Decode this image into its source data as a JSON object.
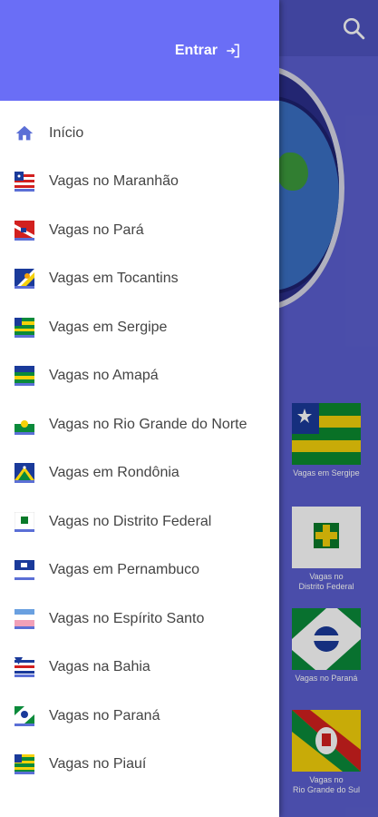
{
  "drawer": {
    "login_label": "Entrar",
    "items": [
      {
        "label": "Início",
        "icon": "home-icon"
      },
      {
        "label": "Vagas no Maranhão",
        "icon": "maranhao-flag-icon"
      },
      {
        "label": "Vagas no Pará",
        "icon": "para-flag-icon"
      },
      {
        "label": "Vagas em Tocantins",
        "icon": "tocantins-flag-icon"
      },
      {
        "label": "Vagas em Sergipe",
        "icon": "sergipe-flag-icon"
      },
      {
        "label": "Vagas no Amapá",
        "icon": "amapa-flag-icon"
      },
      {
        "label": "Vagas no Rio Grande do Norte",
        "icon": "rio-grande-do-norte-flag-icon"
      },
      {
        "label": "Vagas em Rondônia",
        "icon": "rondonia-flag-icon"
      },
      {
        "label": "Vagas no Distrito Federal",
        "icon": "distrito-federal-flag-icon"
      },
      {
        "label": "Vagas em Pernambuco",
        "icon": "pernambuco-flag-icon"
      },
      {
        "label": "Vagas no Espírito Santo",
        "icon": "espirito-santo-flag-icon"
      },
      {
        "label": "Vagas na Bahia",
        "icon": "bahia-flag-icon"
      },
      {
        "label": "Vagas no Paraná",
        "icon": "parana-flag-icon"
      },
      {
        "label": "Vagas no Piauí",
        "icon": "piaui-flag-icon"
      }
    ]
  },
  "background": {
    "cards": [
      {
        "line1": "Vagas em Sergipe",
        "line2": ""
      },
      {
        "line1": "Vagas no",
        "line2": "Distrito Federal"
      },
      {
        "line1": "Vagas no Paraná",
        "line2": ""
      },
      {
        "line1": "Vagas no",
        "line2": "Rio Grande do Sul"
      }
    ]
  },
  "colors": {
    "drawer_header": "#6a6ef6",
    "app_background": "#5b5fd0",
    "menu_text": "#444444"
  }
}
